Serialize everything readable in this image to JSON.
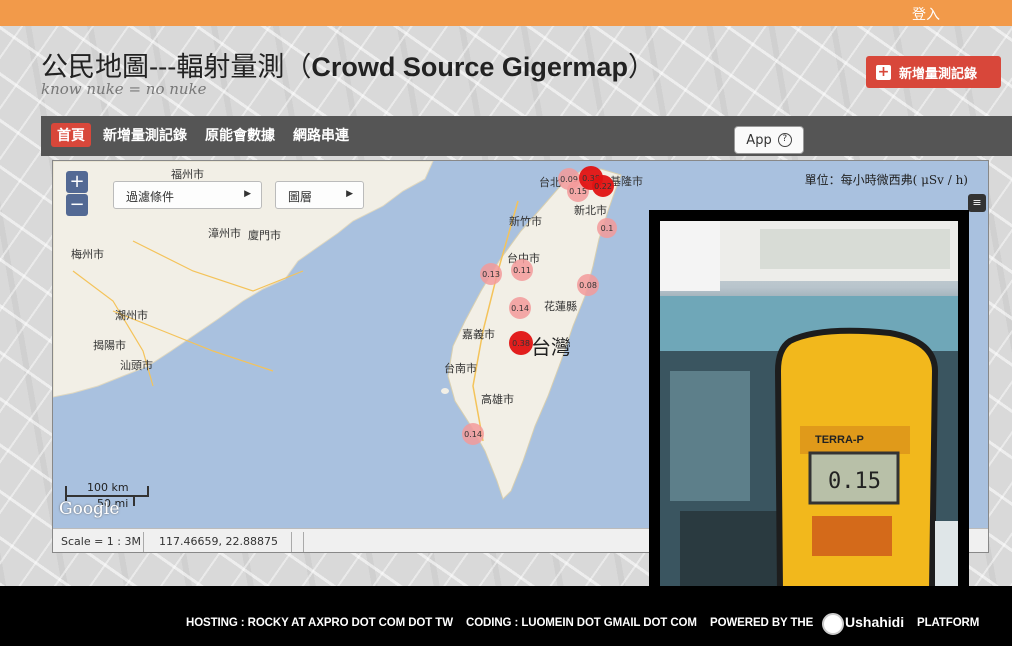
{
  "header": {
    "login": "登入",
    "title_zh": "公民地圖---輻射量測（",
    "title_en": "Crowd Source Gigermap",
    "title_end": "）",
    "tagline": "know nuke = no nuke",
    "add_report_button": "新增量測記錄"
  },
  "nav": {
    "items": [
      "首頁",
      "新增量測記錄",
      "原能會數據",
      "網路串連"
    ],
    "app_button": "App",
    "help_icon": "?"
  },
  "map": {
    "filter_dropdown": "過濾條件",
    "layer_dropdown": "圖層",
    "unit": "單位：每小時微西弗( μSv / h)",
    "zoom_in": "+",
    "zoom_out": "−",
    "scale_km": "100 km",
    "scale_mi": "50 mi",
    "google": "Google",
    "status_scale": "Scale = 1 : 3M",
    "status_coords": "117.46659, 22.88875",
    "place_labels": [
      "福州市",
      "漳州市",
      "廈門市",
      "梅州市",
      "潮州市",
      "揭陽市",
      "汕頭市",
      "台北",
      "基隆市",
      "新北市",
      "新竹市",
      "台中市",
      "花蓮縣",
      "嘉義市",
      "台南市",
      "高雄市",
      "台灣"
    ],
    "markers": [
      {
        "value": "0.13"
      },
      {
        "value": "0.11"
      },
      {
        "value": "0.14"
      },
      {
        "value": "0.38"
      },
      {
        "value": "0.08"
      },
      {
        "value": "0.1"
      },
      {
        "value": "0.14"
      },
      {
        "value": "0.09"
      },
      {
        "value": "0.15"
      },
      {
        "value": "0.38"
      },
      {
        "value": "0.22"
      }
    ],
    "photo_reading": "0.15",
    "photo_device": "TERRA-P"
  },
  "footer": {
    "hosting": "HOSTING : ROCKY AT AXPRO DOT COM DOT TW",
    "coding": "CODING : LUOMEIN DOT GMAIL DOT COM",
    "powered": "POWERED BY THE",
    "brand": "Ushahidi",
    "platform": "PLATFORM"
  },
  "colors": {
    "topbar": "#f29a4a",
    "accent": "#d8473a",
    "nav": "#555555",
    "footer": "#000000",
    "sea": "#a9c1df",
    "land": "#f2efe6"
  }
}
